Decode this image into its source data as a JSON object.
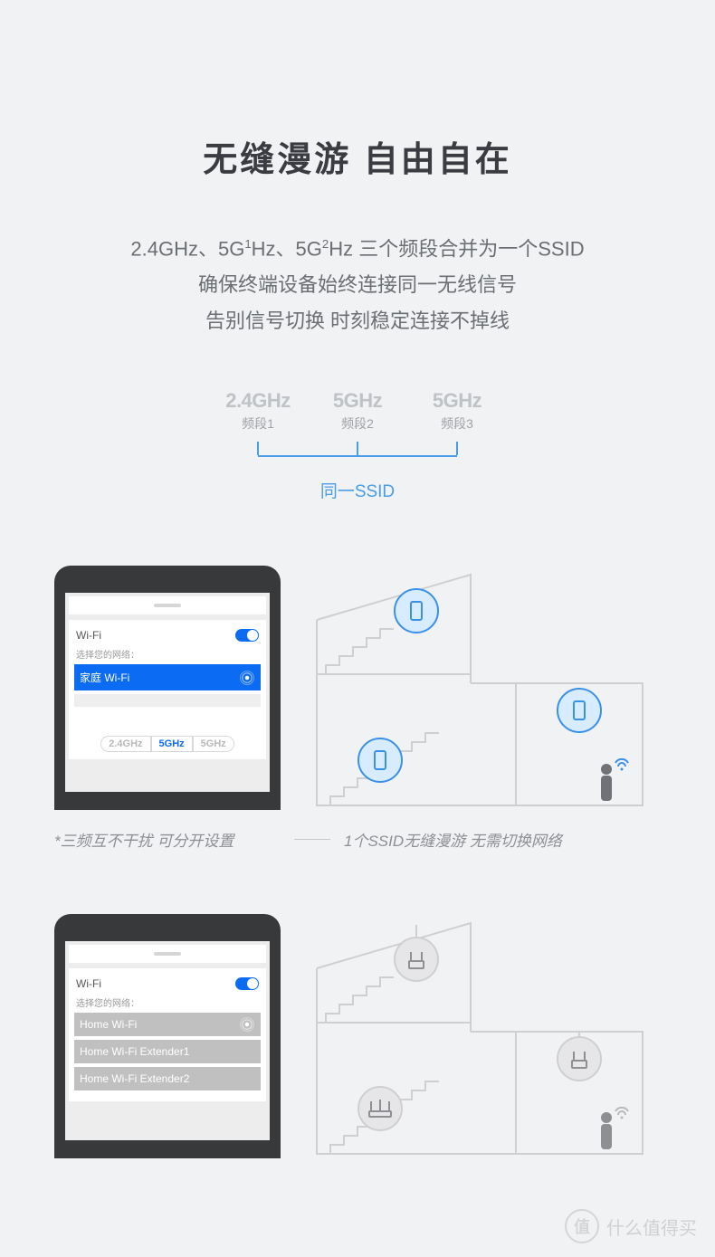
{
  "title": "无缝漫游  自由自在",
  "desc": {
    "line1_a": "2.4GHz、5G",
    "line1_sup1": "1",
    "line1_b": "Hz、5G",
    "line1_sup2": "2",
    "line1_c": "Hz 三个频段合并为一个SSID",
    "line2": "确保终端设备始终连接同一无线信号",
    "line3": "告别信号切换  时刻稳定连接不掉线"
  },
  "bands": [
    {
      "top": "2.4GHz",
      "sub": "频段1"
    },
    {
      "top": "5GHz",
      "sub": "频段2"
    },
    {
      "top": "5GHz",
      "sub": "频段3"
    }
  ],
  "ssid_merge_label": "同一SSID",
  "phone1": {
    "wifi_label": "Wi-Fi",
    "choose_label": "选择您的网络：",
    "network_name": "家庭   Wi-Fi",
    "pills": [
      "2.4GHz",
      "5GHz",
      "5GHz"
    ],
    "pills_active_index": 1
  },
  "caption1_left": "*三频互不干扰 可分开设置",
  "caption1_right": "1个SSID无缝漫游 无需切换网络",
  "phone2": {
    "wifi_label": "Wi-Fi",
    "choose_label": "选择您的网络：",
    "networks": [
      "Home Wi-Fi",
      "Home Wi-Fi Extender1",
      "Home Wi-Fi Extender2"
    ]
  },
  "watermark_text": "什么值得买",
  "watermark_badge": "值"
}
